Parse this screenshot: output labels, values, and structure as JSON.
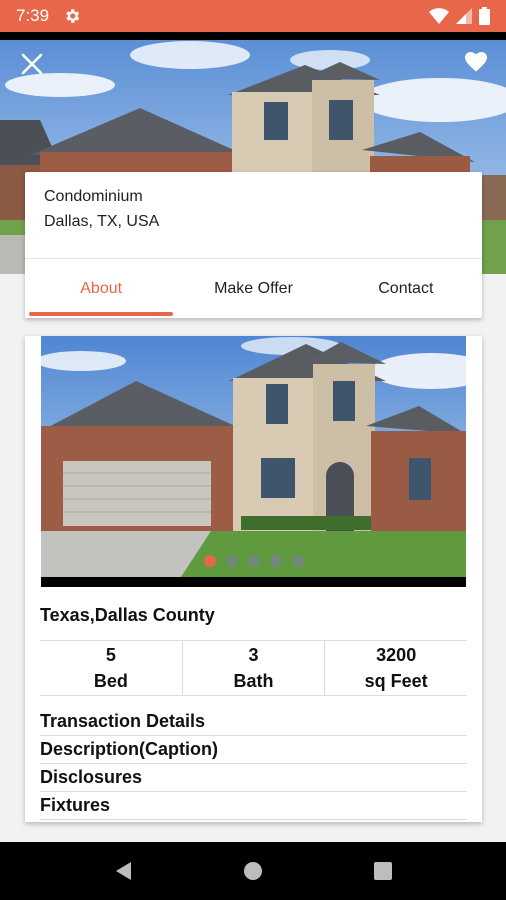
{
  "status_bar": {
    "time": "7:39"
  },
  "listing": {
    "property_type": "Condominium",
    "location": "Dallas, TX, USA"
  },
  "tabs": [
    {
      "label": "About",
      "active": true
    },
    {
      "label": "Make Offer",
      "active": false
    },
    {
      "label": "Contact",
      "active": false
    }
  ],
  "gallery": {
    "image_count": 5,
    "active_index": 0
  },
  "region": "Texas,Dallas County",
  "stats": [
    {
      "value": "5",
      "label": "Bed"
    },
    {
      "value": "3",
      "label": "Bath"
    },
    {
      "value": "3200",
      "label": "sq Feet"
    }
  ],
  "details": [
    "Transaction Details",
    "Description(Caption)",
    "Disclosures",
    "Fixtures"
  ],
  "colors": {
    "accent": "#e8674a",
    "nav_bar": "#000000"
  }
}
